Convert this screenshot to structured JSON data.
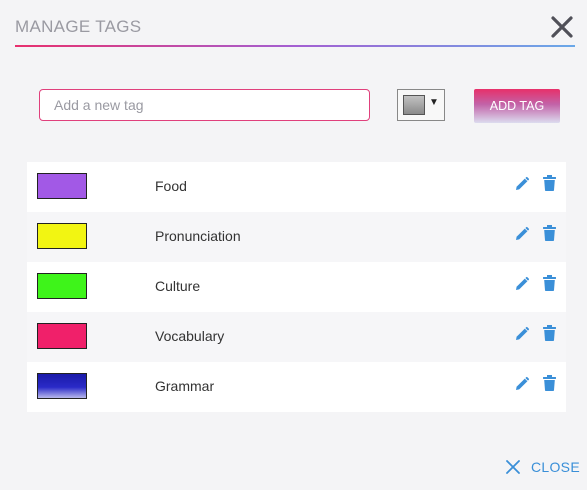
{
  "dialog": {
    "title": "MANAGE TAGS",
    "close_icon": "close-x-icon"
  },
  "add_tag": {
    "placeholder": "Add a new tag",
    "value": "",
    "color_picker_icon": "color-swatch-dropdown",
    "button_label": "ADD TAG"
  },
  "tags": [
    {
      "name": "Food",
      "color": "#a259e6"
    },
    {
      "name": "Pronunciation",
      "color": "#f2f512"
    },
    {
      "name": "Culture",
      "color": "#3ef41a"
    },
    {
      "name": "Vocabulary",
      "color": "#f0206a"
    },
    {
      "name": "Grammar",
      "color": "#2a2ac8"
    }
  ],
  "row_actions": {
    "edit_icon": "pencil-icon",
    "delete_icon": "trash-icon"
  },
  "footer": {
    "close_label": "CLOSE"
  },
  "colors": {
    "accent": "#3a8fd8",
    "brand": "#e8306e"
  }
}
